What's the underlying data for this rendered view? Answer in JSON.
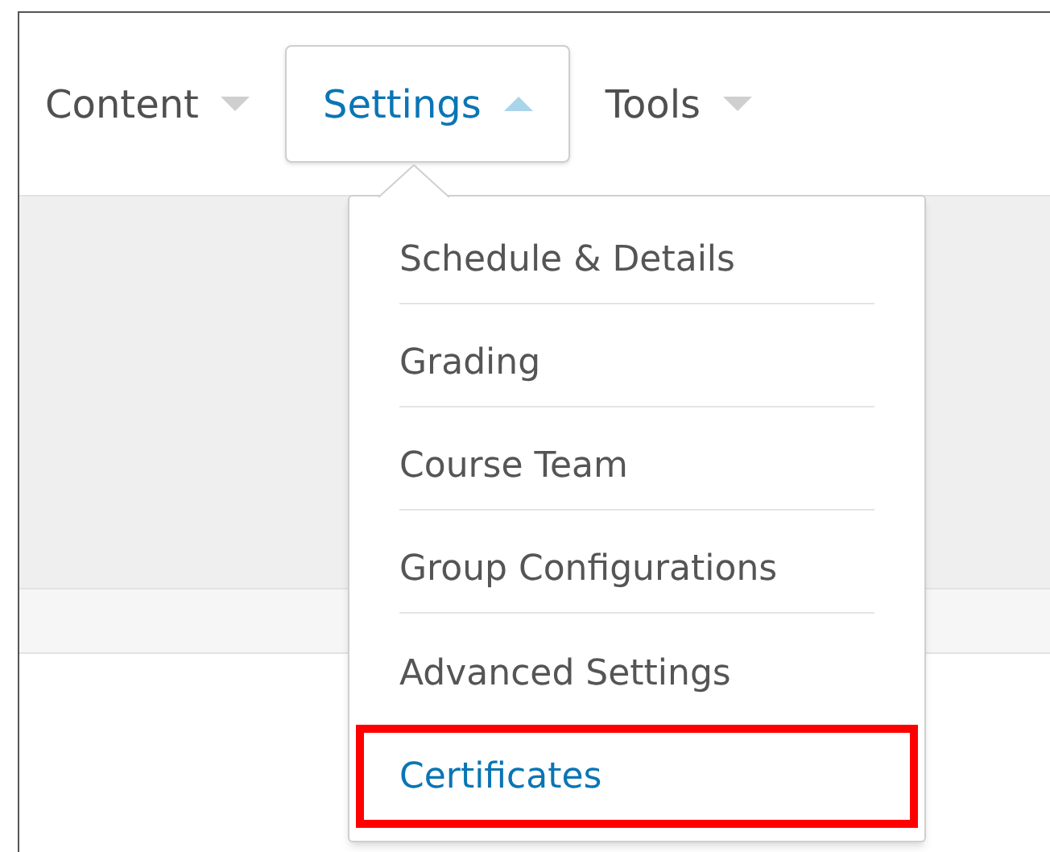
{
  "nav": {
    "tabs": [
      {
        "label": "Content",
        "expanded": false
      },
      {
        "label": "Settings",
        "expanded": true
      },
      {
        "label": "Tools",
        "expanded": false
      }
    ]
  },
  "menu": {
    "items": [
      {
        "label": "Schedule & Details",
        "selected": false,
        "outlined": false
      },
      {
        "label": "Grading",
        "selected": false,
        "outlined": false
      },
      {
        "label": "Course Team",
        "selected": false,
        "outlined": false
      },
      {
        "label": "Group Configurations",
        "selected": false,
        "outlined": false
      },
      {
        "label": "Advanced Settings",
        "selected": false,
        "outlined": false
      },
      {
        "label": "Certificates",
        "selected": true,
        "outlined": true
      }
    ]
  }
}
